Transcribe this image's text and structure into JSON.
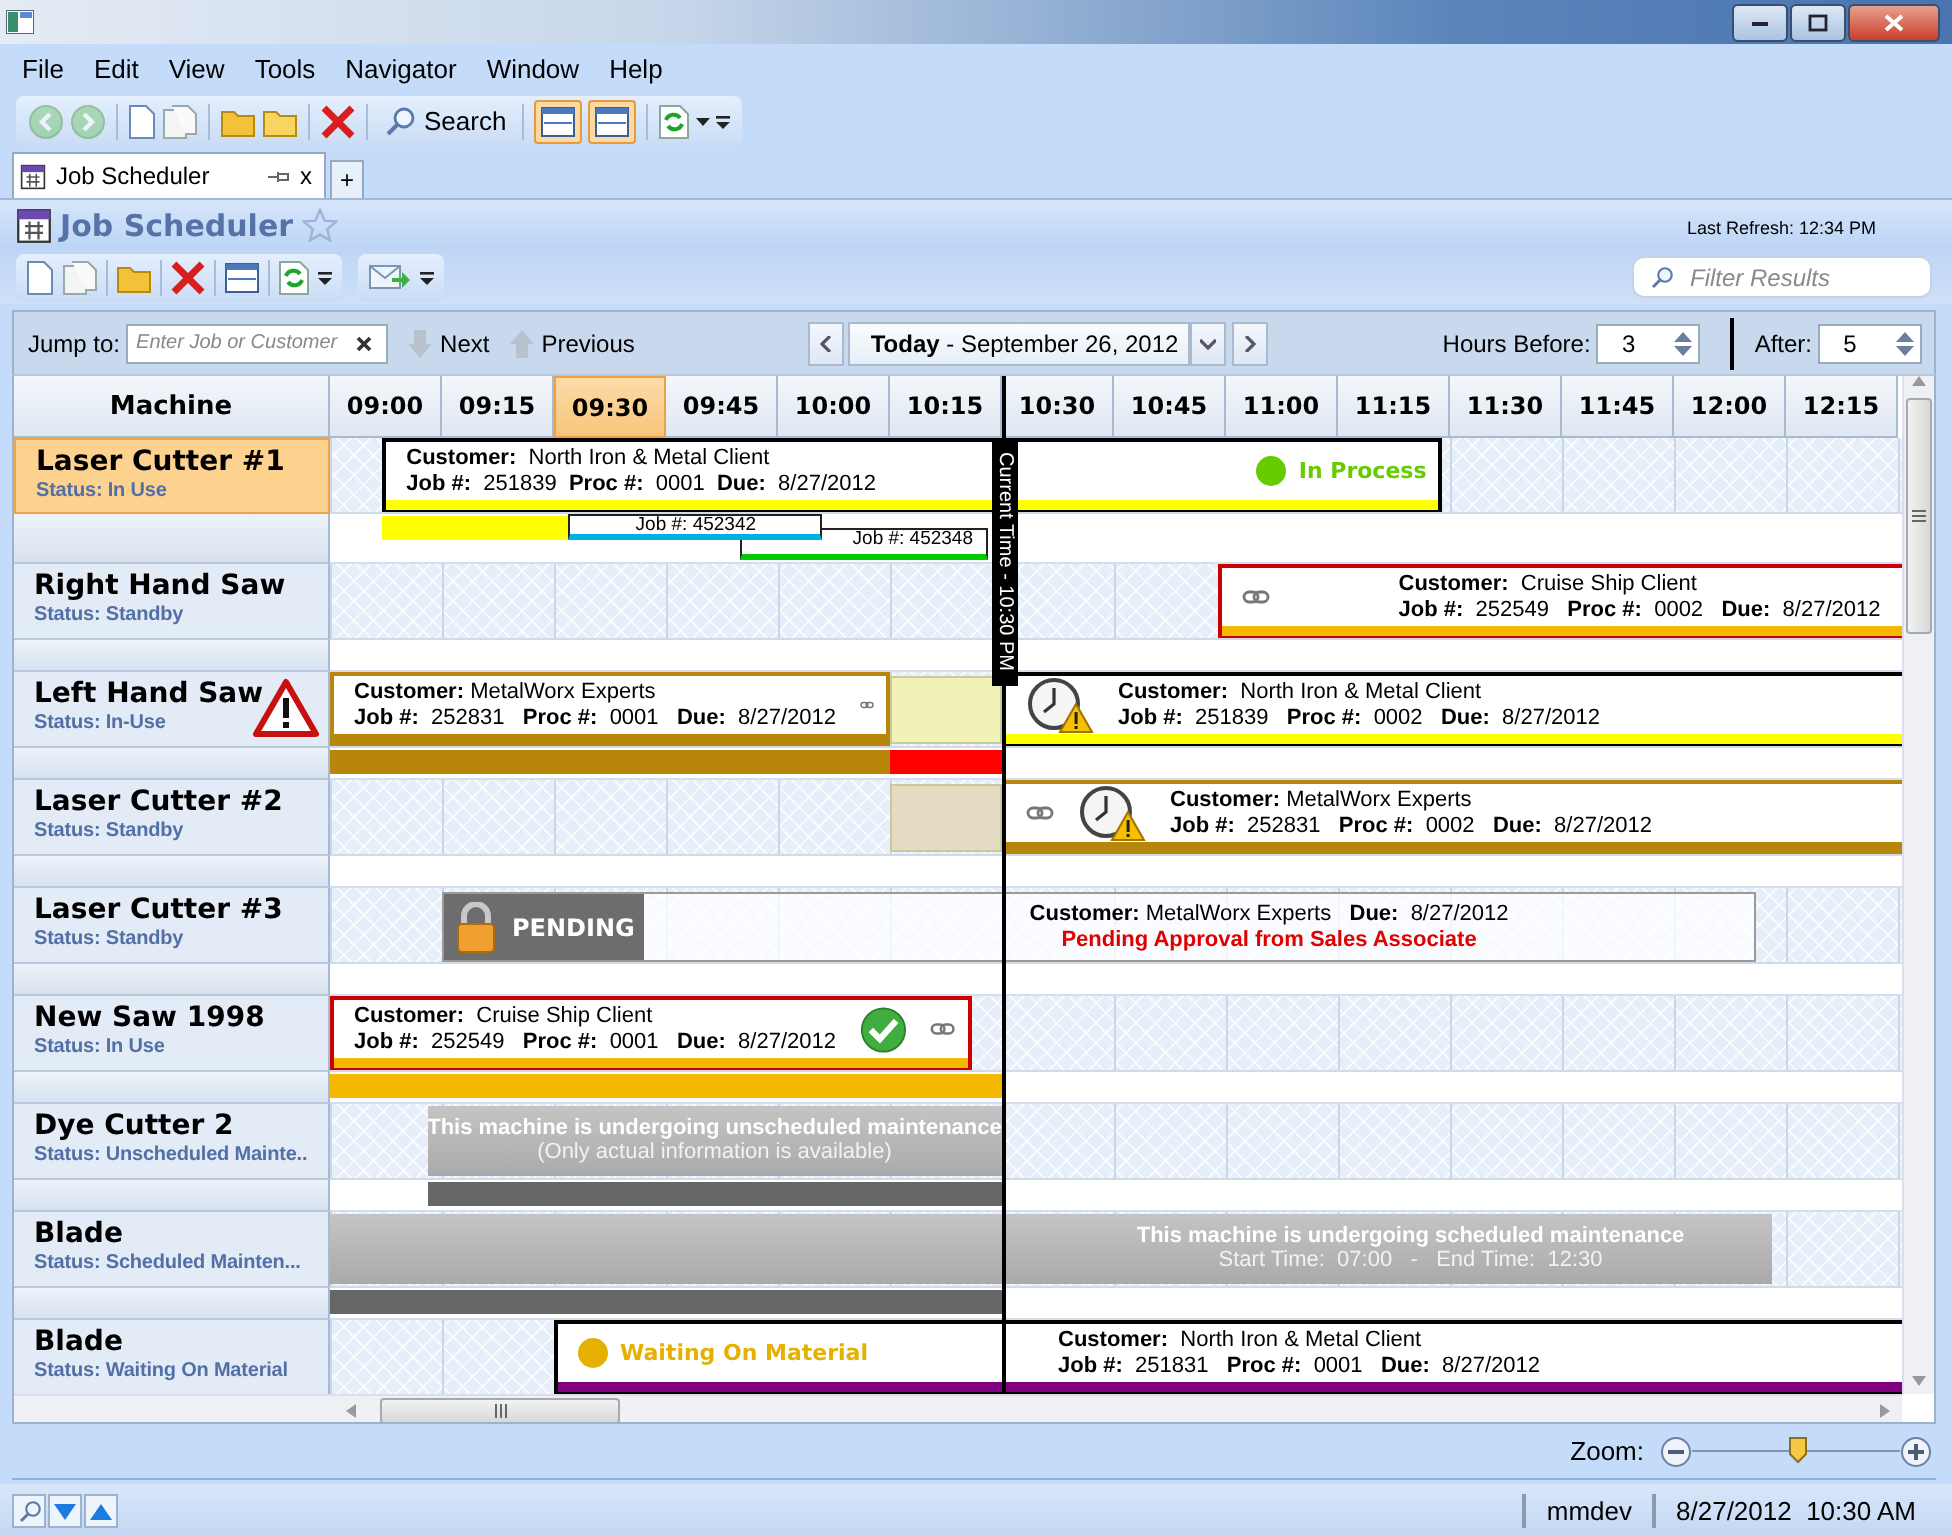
{
  "menu": [
    "File",
    "Edit",
    "View",
    "Tools",
    "Navigator",
    "Window",
    "Help"
  ],
  "toolbar": {
    "search": "Search",
    "view_toggles": [
      {
        "selected": true
      },
      {
        "selected": true
      }
    ]
  },
  "tabs": [
    {
      "label": "Job Scheduler",
      "selected": true,
      "close": "x"
    }
  ],
  "new_tab": "+",
  "page": {
    "title": "Job Scheduler",
    "last_refresh": "Last Refresh:  12:34 PM",
    "filter_placeholder": "Filter Results"
  },
  "controls": {
    "jump_label": "Jump to:",
    "jump_placeholder": "Enter Job or Customer",
    "next": "Next",
    "previous": "Previous",
    "date": "**Today** - September 26, 2012",
    "hours_before_label": "Hours Before:",
    "hours_before": "3",
    "after_label": "After:",
    "after": "5"
  },
  "schedule": {
    "machine_header": "Machine",
    "columns": [
      {
        "label": "09:00",
        "selected": false
      },
      {
        "label": "09:15",
        "selected": false
      },
      {
        "label": "09:30",
        "selected": true
      },
      {
        "label": "09:45",
        "selected": false
      },
      {
        "label": "10:00",
        "selected": false
      },
      {
        "label": "10:15",
        "selected": false
      },
      {
        "label": "10:30",
        "selected": false
      },
      {
        "label": "10:45",
        "selected": false
      },
      {
        "label": "11:00",
        "selected": false
      },
      {
        "label": "11:15",
        "selected": false
      },
      {
        "label": "11:30",
        "selected": false
      },
      {
        "label": "11:45",
        "selected": false
      },
      {
        "label": "12:00",
        "selected": false
      },
      {
        "label": "12:15",
        "selected": false
      }
    ],
    "current_time_label": "Current Time - 10:30 PM",
    "machines": [
      {
        "name": "Laser Cutter #1",
        "status": "Status:  In Use",
        "selected": true,
        "warning": false,
        "bars": [
          {
            "kind": "job",
            "color": "#ffff00",
            "state": {
              "label": "In Process",
              "color": "#66cc00"
            },
            "customer": "**Customer:**  North Iron & Metal Client",
            "details": "**Job #:**  251839  **Proc #:**  0001  **Due:**  8/27/2012"
          },
          {
            "kind": "band",
            "color": "#ffff00"
          },
          {
            "kind": "tag",
            "label": "Job #: 452342",
            "color": "#00b0e0"
          },
          {
            "kind": "tag",
            "label": "Job #: 452348",
            "color": "#00cc00"
          }
        ]
      },
      {
        "name": "Right Hand Saw",
        "status": "Status:  Standby",
        "selected": false,
        "warning": false,
        "bars": [
          {
            "kind": "job",
            "color": "#f5b800",
            "customer": "**Customer:**  Cruise Ship Client",
            "details": "**Job #:**  252549   **Proc #:**  0002   **Due:**  8/27/2012"
          }
        ]
      },
      {
        "name": "Left Hand Saw",
        "status": "Status:  In-Use",
        "selected": false,
        "warning": true,
        "bars": [
          {
            "kind": "job",
            "color": "#b8860b",
            "customer": "**Customer:** MetalWorx Experts",
            "details": "**Job #:**  252831   **Proc #:**  0001   **Due:**  8/27/2012"
          },
          {
            "kind": "ghost",
            "color": "#f2f2b8"
          },
          {
            "kind": "delayed_job",
            "color": "#ffff00",
            "customer": "**Customer:**  North Iron & Metal Client",
            "details": "**Job #:**  251839   **Proc #:**  0002   **Due:**  8/27/2012"
          },
          {
            "kind": "band",
            "color": "#b8860b"
          },
          {
            "kind": "band",
            "color": "#ff0000"
          }
        ]
      },
      {
        "name": "Laser Cutter #2",
        "status": "Status:  Standby",
        "selected": false,
        "warning": false,
        "bars": [
          {
            "kind": "ghost",
            "color": "#e6dcc4"
          },
          {
            "kind": "delayed_job",
            "color": "#b8860b",
            "customer": "**Customer:** MetalWorx Experts",
            "details": "**Job #:**  252831   **Proc #:**  0002   **Due:**  8/27/2012"
          }
        ]
      },
      {
        "name": "Laser Cutter #3",
        "status": "Status:  Standby",
        "selected": false,
        "warning": false,
        "bars": [
          {
            "kind": "pending",
            "label": "PENDING",
            "customer": "**Customer:** MetalWorx Experts   **Due:**  8/27/2012",
            "note": "Pending Approval from Sales Associate"
          }
        ]
      },
      {
        "name": "New Saw 1998",
        "status": "Status:  In Use",
        "selected": false,
        "warning": false,
        "bars": [
          {
            "kind": "completed_job",
            "color": "#f5b800",
            "customer": "**Customer:**  Cruise Ship Client",
            "details": "**Job #:**  252549   **Proc #:**  0001   **Due:**  8/27/2012"
          },
          {
            "kind": "band",
            "color": "#f5b800"
          }
        ]
      },
      {
        "name": "Dye Cutter 2",
        "status": "Status:  Unscheduled Mainte..",
        "selected": false,
        "warning": false,
        "bars": [
          {
            "kind": "maintenance",
            "title": "This machine is undergoing unscheduled maintenance",
            "detail": "(Only actual information is available)"
          },
          {
            "kind": "band",
            "color": "#666666"
          }
        ]
      },
      {
        "name": "Blade",
        "status": "Status:  Scheduled Mainten...",
        "selected": false,
        "warning": false,
        "bars": [
          {
            "kind": "maintenance",
            "title": "This machine is undergoing scheduled maintenance",
            "detail": "Start Time:  07:00   -   End Time:  12:30"
          },
          {
            "kind": "band",
            "color": "#666666"
          }
        ]
      },
      {
        "name": "Blade",
        "status": "Status:  Waiting On Material",
        "selected": false,
        "warning": false,
        "bars": [
          {
            "kind": "job",
            "color": "#800080",
            "state": {
              "label": "Waiting On Material",
              "color": "#e6b000"
            },
            "customer": "**Customer:**  North Iron & Metal Client",
            "details": "**Job #:**  251831   **Proc #:**  0001   **Due:**  8/27/2012"
          }
        ]
      }
    ]
  },
  "zoom": {
    "label": "Zoom:",
    "level": 0.51
  },
  "status_bar": {
    "user": "mmdev",
    "datetime": "8/27/2012  10:30 AM"
  }
}
